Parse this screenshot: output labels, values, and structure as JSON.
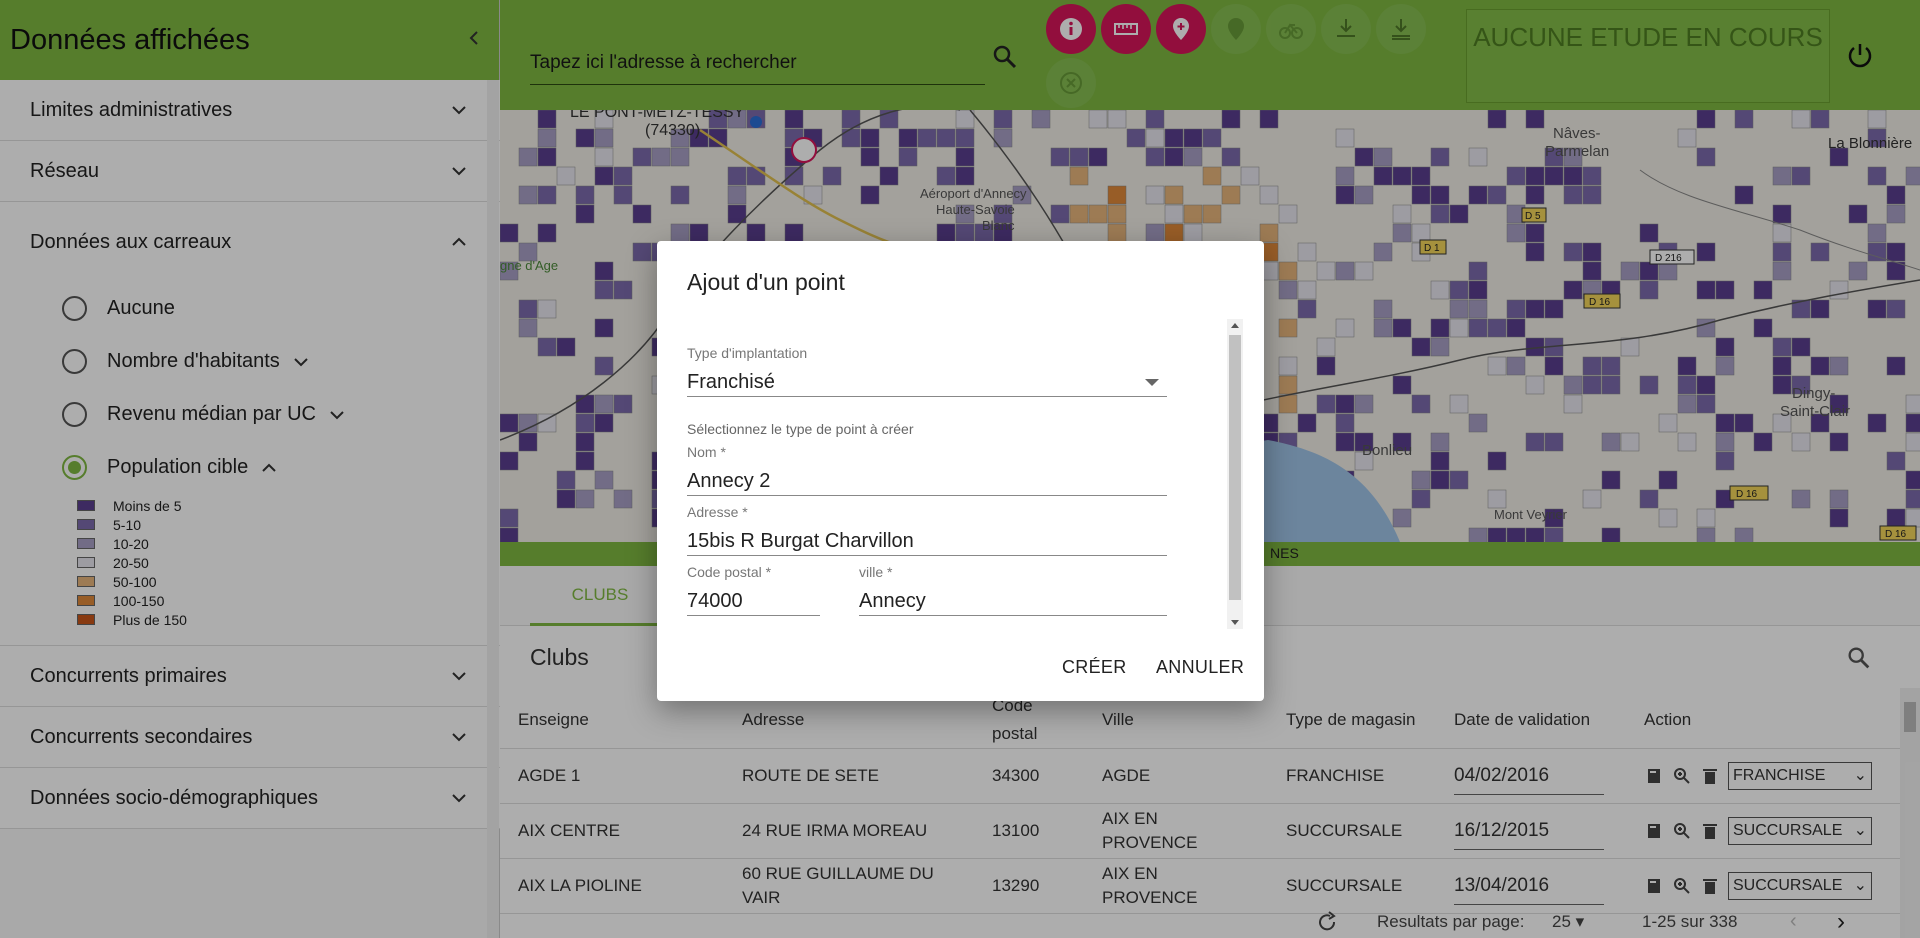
{
  "sidebar": {
    "title": "Données affichées",
    "panels": [
      {
        "label": "Limites administratives"
      },
      {
        "label": "Réseau"
      },
      {
        "label": "Données aux carreaux"
      },
      {
        "label": "Concurrents primaires"
      },
      {
        "label": "Concurrents secondaires"
      },
      {
        "label": "Données socio-démographiques"
      }
    ],
    "radios": [
      {
        "label": "Aucune",
        "checked": false
      },
      {
        "label": "Nombre d'habitants",
        "checked": false
      },
      {
        "label": "Revenu médian par UC",
        "checked": false
      },
      {
        "label": "Population cible",
        "checked": true
      }
    ],
    "legend": [
      {
        "label": "Moins de 5",
        "color": "#5a3f8f"
      },
      {
        "label": "5-10",
        "color": "#7d6aad"
      },
      {
        "label": "10-20",
        "color": "#a99fc6"
      },
      {
        "label": "20-50",
        "color": "#e8e6ef"
      },
      {
        "label": "50-100",
        "color": "#e8b67c"
      },
      {
        "label": "100-150",
        "color": "#e0893a"
      },
      {
        "label": "Plus de 150",
        "color": "#c9561a"
      }
    ]
  },
  "topbar": {
    "search_placeholder": "Tapez ici l'adresse à rechercher",
    "study_status": "AUCUNE ETUDE EN COURS"
  },
  "map": {
    "labels": {
      "town1": "LE PONT-METZ-TESSY",
      "town1_code": "(74330)",
      "airport1": "Aéroport d'Annecy",
      "airport2": "Haute-Savoie",
      "airport3": "Blanc",
      "parmelan1": "Nâves-",
      "parmelan2": "Parmelan",
      "bio": "La Blonnière",
      "dingy1": "Dingy-",
      "dingy2": "Saint-Clair",
      "veyrier": "Mont Veyrier",
      "bonlieu": "Bonlieu",
      "age": "gne d'Age",
      "road_d5": "D 5",
      "road_d16a": "D 16",
      "road_d216": "D 216",
      "road_d16b": "D 16",
      "road_d16c": "D 16",
      "road_d1": "D 1"
    },
    "strip_label": "NES"
  },
  "tabs": {
    "clubs": "CLUBS"
  },
  "table": {
    "title": "Clubs",
    "headers": [
      "Enseigne",
      "Adresse",
      "Code postal",
      "Ville",
      "Type de magasin",
      "Date de validation",
      "Action"
    ],
    "rows": [
      {
        "enseigne": "AGDE 1",
        "adresse": "ROUTE DE SETE",
        "cp": "34300",
        "ville": "AGDE",
        "type": "FRANCHISE",
        "date": "04/02/2016",
        "select": "FRANCHISE"
      },
      {
        "enseigne": "AIX CENTRE",
        "adresse": "24 RUE IRMA MOREAU",
        "cp": "13100",
        "ville": "AIX EN PROVENCE",
        "type": "SUCCURSALE",
        "date": "16/12/2015",
        "select": "SUCCURSALE"
      },
      {
        "enseigne": "AIX LA PIOLINE",
        "adresse": "60 RUE GUILLAUME DU VAIR",
        "cp": "13290",
        "ville": "AIX EN PROVENCE",
        "type": "SUCCURSALE",
        "date": "13/04/2016",
        "select": "SUCCURSALE"
      }
    ],
    "paginator": {
      "label": "Resultats par page:",
      "page_size": "25",
      "range": "1-25 sur 338"
    }
  },
  "dialog": {
    "title": "Ajout d'un point",
    "type_label": "Type d'implantation",
    "type_value": "Franchisé",
    "type_hint": "Sélectionnez le type de point à créer",
    "nom_label": "Nom *",
    "nom_value": "Annecy 2",
    "adresse_label": "Adresse *",
    "adresse_value": "15bis R Burgat Charvillon",
    "cp_label": "Code postal *",
    "cp_value": "74000",
    "ville_label": "ville *",
    "ville_value": "Annecy",
    "create": "CRÉER",
    "cancel": "ANNULER"
  },
  "colors": {
    "brand_green": "#7fb842",
    "tool_active": "#d8155b"
  }
}
